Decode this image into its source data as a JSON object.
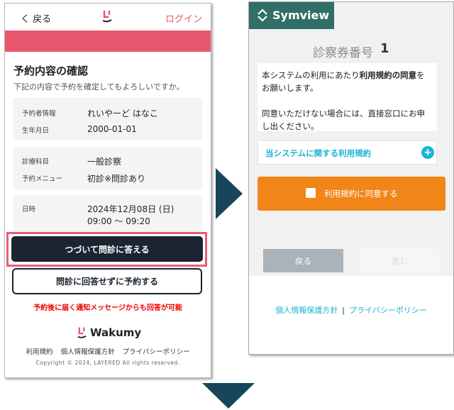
{
  "left_screen": {
    "header": {
      "back_label": "く 戻る",
      "login_label": "ログイン"
    },
    "title": "予約内容の確認",
    "subtitle": "下記の内容で予約を確定してもよろしいですか。",
    "card1": {
      "label_name": "予約者情報",
      "value_name": "れいやーど はなこ",
      "label_dob": "生年月日",
      "value_dob": "2000-01-01"
    },
    "card2": {
      "label_dept": "診療科目",
      "value_dept": "一般診察",
      "label_menu": "予約メニュー",
      "value_menu": "初診※問診あり"
    },
    "card3": {
      "label_datetime": "日時",
      "value_date": "2024年12月08日 (日)",
      "value_time": "09:00 ～ 09:20"
    },
    "continue_button": "つづいて問診に答える",
    "skip_button": "問診に回答せずに予約する",
    "note": "予約後に届く通知メッセージからも回答が可能",
    "brand": "Wakumy",
    "footer_links": [
      "利用規約",
      "個人情報保護方針",
      "プライバシーポリシー"
    ],
    "copyright": "Copyright © 2024, LAYERED All rights reserved."
  },
  "right_screen": {
    "brand": "Symview",
    "exam_label": "診察券番号",
    "exam_number": "1",
    "message_part1": "本システムの利用にあたり",
    "message_bold": "利用規約の同意",
    "message_part2": "をお願いします。",
    "message_line2": "同意いただけない場合には、直接窓口にお申し出ください。",
    "terms_label": "当システムに関する利用規約",
    "terms_toggle": "+",
    "agree_label": "利用規約に同意する",
    "back_button": "戻る",
    "next_button": "進む",
    "footer_link1": "個人情報保護方針",
    "footer_sep": "|",
    "footer_link2": "プライバシーポリシー"
  },
  "colors": {
    "pink": "#e8566d",
    "navy": "#1b2430",
    "teal": "#2f6f67",
    "orange": "#f28518",
    "cyan": "#1ab3d6",
    "arrow": "#17465a"
  }
}
